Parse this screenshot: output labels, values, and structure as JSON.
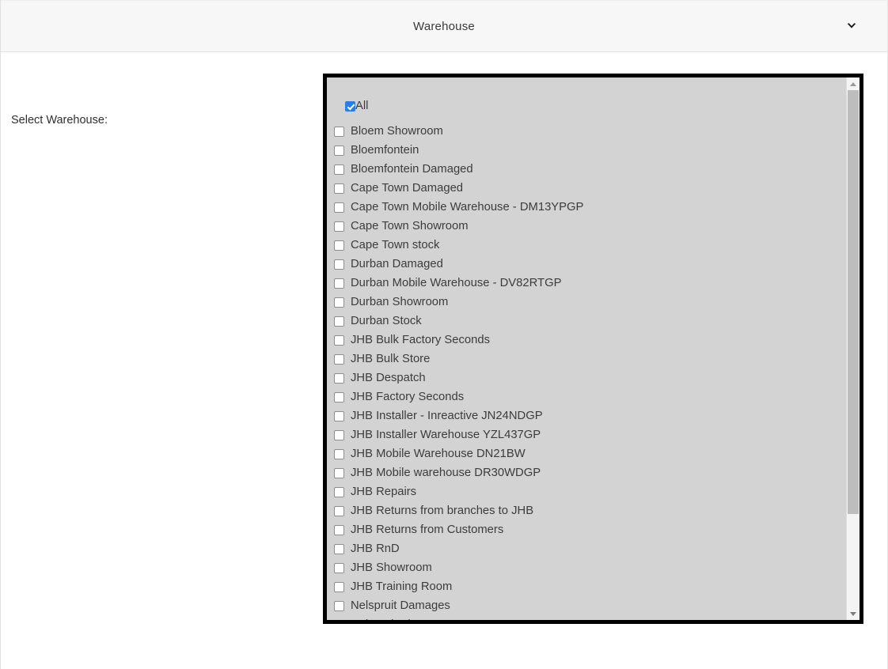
{
  "header": {
    "title": "Warehouse",
    "chevron_icon": "chevron-down-icon"
  },
  "form": {
    "field_label": "Select Warehouse:"
  },
  "listbox": {
    "all_option": {
      "label": "All",
      "checked": true
    },
    "options": [
      {
        "label": "Bloem Showroom",
        "checked": false
      },
      {
        "label": "Bloemfontein",
        "checked": false
      },
      {
        "label": "Bloemfontein Damaged",
        "checked": false
      },
      {
        "label": "Cape Town Damaged",
        "checked": false
      },
      {
        "label": "Cape Town Mobile Warehouse - DM13YPGP",
        "checked": false
      },
      {
        "label": "Cape Town Showroom",
        "checked": false
      },
      {
        "label": "Cape Town stock",
        "checked": false
      },
      {
        "label": "Durban Damaged",
        "checked": false
      },
      {
        "label": "Durban Mobile Warehouse - DV82RTGP",
        "checked": false
      },
      {
        "label": "Durban Showroom",
        "checked": false
      },
      {
        "label": "Durban Stock",
        "checked": false
      },
      {
        "label": "JHB Bulk Factory Seconds",
        "checked": false
      },
      {
        "label": "JHB Bulk Store",
        "checked": false
      },
      {
        "label": "JHB Despatch",
        "checked": false
      },
      {
        "label": "JHB Factory Seconds",
        "checked": false
      },
      {
        "label": "JHB Installer - Inreactive JN24NDGP",
        "checked": false
      },
      {
        "label": "JHB Installer Warehouse YZL437GP",
        "checked": false
      },
      {
        "label": "JHB Mobile Warehouse DN21BW",
        "checked": false
      },
      {
        "label": "JHB Mobile warehouse DR30WDGP",
        "checked": false
      },
      {
        "label": "JHB Repairs",
        "checked": false
      },
      {
        "label": "JHB Returns from branches to JHB",
        "checked": false
      },
      {
        "label": "JHB Returns from Customers",
        "checked": false
      },
      {
        "label": "JHB RnD",
        "checked": false
      },
      {
        "label": "JHB Showroom",
        "checked": false
      },
      {
        "label": "JHB Training Room",
        "checked": false
      },
      {
        "label": "Nelspruit Damages",
        "checked": false
      },
      {
        "label": "Nelspruit Showroom",
        "checked": false
      }
    ],
    "scrollbar": {
      "up_icon": "scroll-up-arrow-icon",
      "down_icon": "scroll-down-arrow-icon",
      "thumb_percent": 82
    }
  },
  "colors": {
    "checkbox_checked": "#2a7fe4",
    "listbox_background": "#d3d3d3",
    "listbox_border": "#000000",
    "header_background": "#f7f7f7",
    "text": "#3c3c3c"
  }
}
